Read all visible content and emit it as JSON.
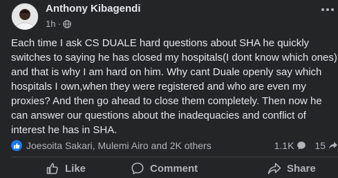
{
  "post": {
    "author": "Anthony Kibagendi",
    "time": "1h",
    "separator": "·",
    "privacy_icon": "globe-icon",
    "lines": [
      "Each time I ask CS DUALE hard questions about SHA he quickly",
      "switches to saying he has closed my hospitals(I dont know which ones)",
      "and that is why I am hard on him. Why cant Duale openly say which",
      "hospitals I own,when they were registered and who are even my",
      "proxies?  And then go ahead to close them completely.  Then now he",
      "can answer our questions about the inadequacies and conflict of",
      "interest he has in SHA."
    ]
  },
  "engagement": {
    "reaction_icon": "like-reaction-icon",
    "reactors": "Joesoita Sakari, Mulemi Airo and 2K others",
    "comments_count": "1.1K",
    "shares_count": "15"
  },
  "actions": {
    "like": "Like",
    "comment": "Comment",
    "share": "Share"
  },
  "colors": {
    "background": "#242526",
    "primary_text": "#e4e6eb",
    "secondary_text": "#b0b3b8",
    "accent": "#1877f2"
  }
}
